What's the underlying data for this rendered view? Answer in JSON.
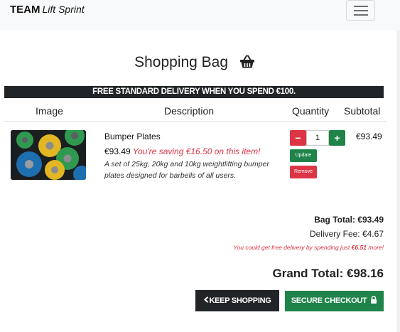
{
  "navbar": {
    "brand_main": "TEAM",
    "brand_sub": "Lift Sprint",
    "menu_icon": "hamburger-menu-icon"
  },
  "page": {
    "title": "Shopping Bag",
    "title_icon": "shopping-basket-icon",
    "delivery_banner": "FREE STANDARD DELIVERY WHEN YOU SPEND €100."
  },
  "table": {
    "headers": [
      "Image",
      "Description",
      "Quantity",
      "Subtotal"
    ],
    "items": [
      {
        "name": "Bumper Plates",
        "price": "€93.49",
        "saving": "You're saving €16.50 on this item!",
        "description": "A set of 25kg, 20kg and 10kg weightlifting bumper plates designed for barbells of all users.",
        "quantity": "1",
        "minus_label": "−",
        "plus_label": "+",
        "update_label": "Update",
        "remove_label": "Remove",
        "subtotal": "€93.49"
      }
    ]
  },
  "summary": {
    "bag_total": "Bag Total: €93.49",
    "delivery_fee": "Delivery Fee: €4.67",
    "free_note_prefix": "You could get free delivery by spending just ",
    "free_note_amount": "€6.51",
    "free_note_suffix": " more!",
    "grand_total": "Grand Total: €98.16"
  },
  "actions": {
    "keep_shopping": "KEEP SHOPPING",
    "keep_icon": "chevron-left-icon",
    "secure_checkout": "SECURE CHECKOUT",
    "checkout_icon": "lock-icon"
  },
  "colors": {
    "danger": "#dc3545",
    "success": "#1e8449",
    "dark": "#222527",
    "navbar_bg": "#f8f9fa"
  }
}
